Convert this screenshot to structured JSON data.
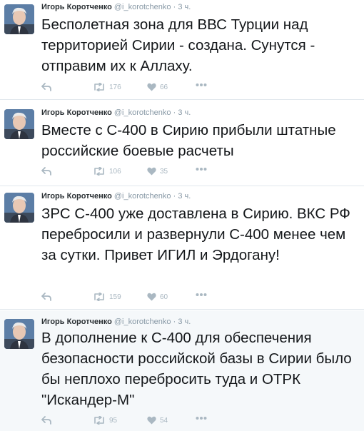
{
  "tweets": [
    {
      "name": "Игорь Коротченко",
      "handle": "@i_korotchenko",
      "time": "3 ч.",
      "text": "Бесполетная зона для ВВС Турции над территорией Сирии - создана. Сунутся - отправим их к Аллаху.",
      "retweets": "176",
      "likes": "66"
    },
    {
      "name": "Игорь Коротченко",
      "handle": "@i_korotchenko",
      "time": "3 ч.",
      "text": "Вместе с С-400 в Сирию прибыли штатные российские боевые расчеты",
      "retweets": "106",
      "likes": "35"
    },
    {
      "name": "Игорь Коротченко",
      "handle": "@i_korotchenko",
      "time": "3 ч.",
      "text": "ЗРС С-400 уже доставлена в Сирию. ВКС РФ перебросили и развернули С-400 менее чем за сутки. Привет ИГИЛ и Эрдогану!",
      "retweets": "159",
      "likes": "60"
    },
    {
      "name": "Игорь Коротченко",
      "handle": "@i_korotchenko",
      "time": "3 ч.",
      "text": "В дополнение к С-400 для обеспечения безопасности российской базы в Сирии было бы неплохо перебросить туда и ОТРК \"Искандер-М\"",
      "retweets": "95",
      "likes": "54"
    }
  ],
  "icons": {
    "reply": "reply-icon",
    "retweet": "retweet-icon",
    "like": "heart-icon",
    "more": "more-icon"
  },
  "colors": {
    "icon_gray": "#aab8c2",
    "secondary_text": "#8899a6",
    "last_tweet_background": "#f5f8fa"
  }
}
